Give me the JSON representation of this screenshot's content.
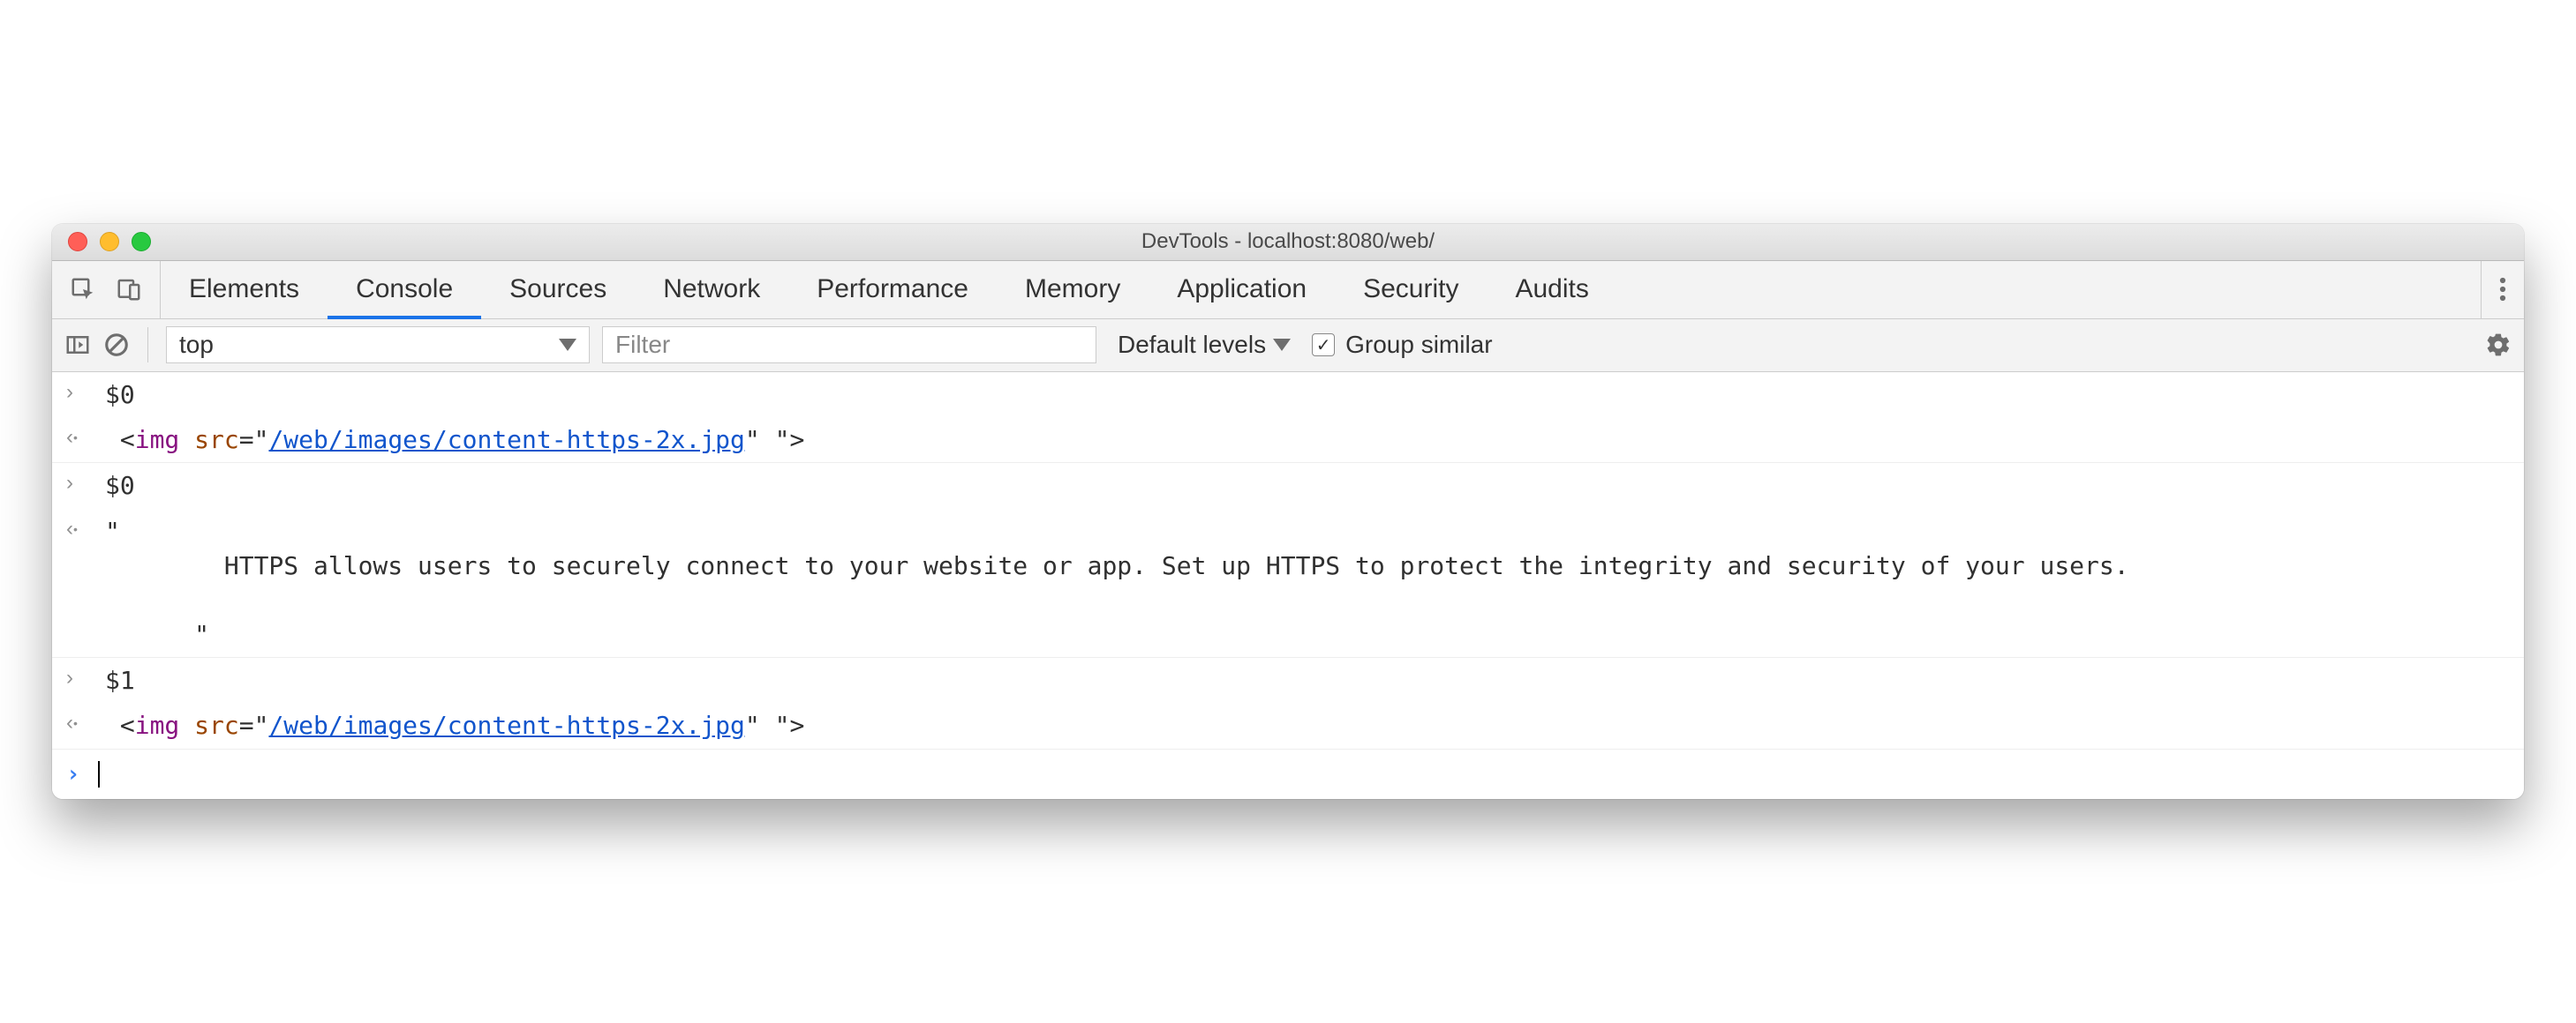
{
  "window": {
    "title": "DevTools - localhost:8080/web/"
  },
  "tabs": [
    {
      "label": "Elements",
      "active": false
    },
    {
      "label": "Console",
      "active": true
    },
    {
      "label": "Sources",
      "active": false
    },
    {
      "label": "Network",
      "active": false
    },
    {
      "label": "Performance",
      "active": false
    },
    {
      "label": "Memory",
      "active": false
    },
    {
      "label": "Application",
      "active": false
    },
    {
      "label": "Security",
      "active": false
    },
    {
      "label": "Audits",
      "active": false
    }
  ],
  "toolbar": {
    "context": "top",
    "filter_placeholder": "Filter",
    "levels": "Default levels",
    "group_similar": "Group similar",
    "group_similar_checked": true
  },
  "entries": [
    {
      "kind": "input",
      "text": "$0"
    },
    {
      "kind": "output",
      "html_parts": {
        "prefix": " <",
        "tag": "img",
        "sp": " ",
        "attr": "src",
        "eq": "=\"",
        "link": "/web/images/content-https-2x.jpg",
        "suffix": "\" \">"
      }
    },
    {
      "kind": "input",
      "text": "$0"
    },
    {
      "kind": "output",
      "text": "\"\n        HTTPS allows users to securely connect to your website or app. Set up HTTPS to protect the integrity and security of your users.\n\n      \""
    },
    {
      "kind": "input",
      "text": "$1"
    },
    {
      "kind": "output",
      "html_parts": {
        "prefix": " <",
        "tag": "img",
        "sp": " ",
        "attr": "src",
        "eq": "=\"",
        "link": "/web/images/content-https-2x.jpg",
        "suffix": "\" \">"
      }
    }
  ]
}
